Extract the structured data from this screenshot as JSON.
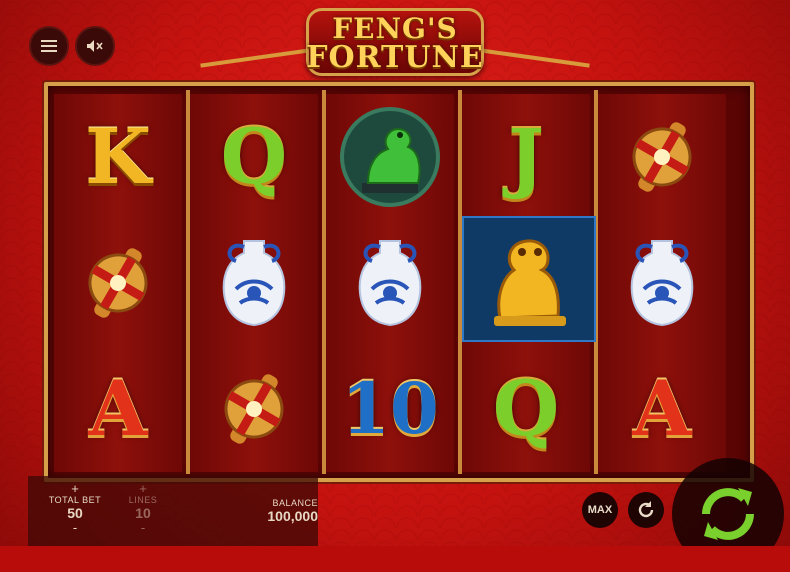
{
  "logo": {
    "line1": "FENG'S",
    "line2": "FORTUNE"
  },
  "controls": {
    "menu_icon": "hamburger-icon",
    "sound_icon": "speaker-muted-icon"
  },
  "reels": [
    [
      "K",
      "coin",
      "A"
    ],
    [
      "Q",
      "vase",
      "coin"
    ],
    [
      "dragon",
      "vase",
      "10"
    ],
    [
      "J",
      "foo-dog",
      "Q"
    ],
    [
      "coin",
      "vase",
      "A"
    ]
  ],
  "bets": {
    "total_bet_label": "TOTAL BET",
    "total_bet_value": "50",
    "lines_label": "LINES",
    "lines_value": "10",
    "balance_label": "BALANCE",
    "balance_value": "100,000",
    "plus": "+",
    "minus": "-"
  },
  "buttons": {
    "max_label": "MAX",
    "autoplay_icon": "autoplay-icon",
    "spin_icon": "spin-icon"
  },
  "colors": {
    "background": "#c4120f",
    "frame_gold": "#d6a04a",
    "spin_green": "#7ad12e"
  }
}
